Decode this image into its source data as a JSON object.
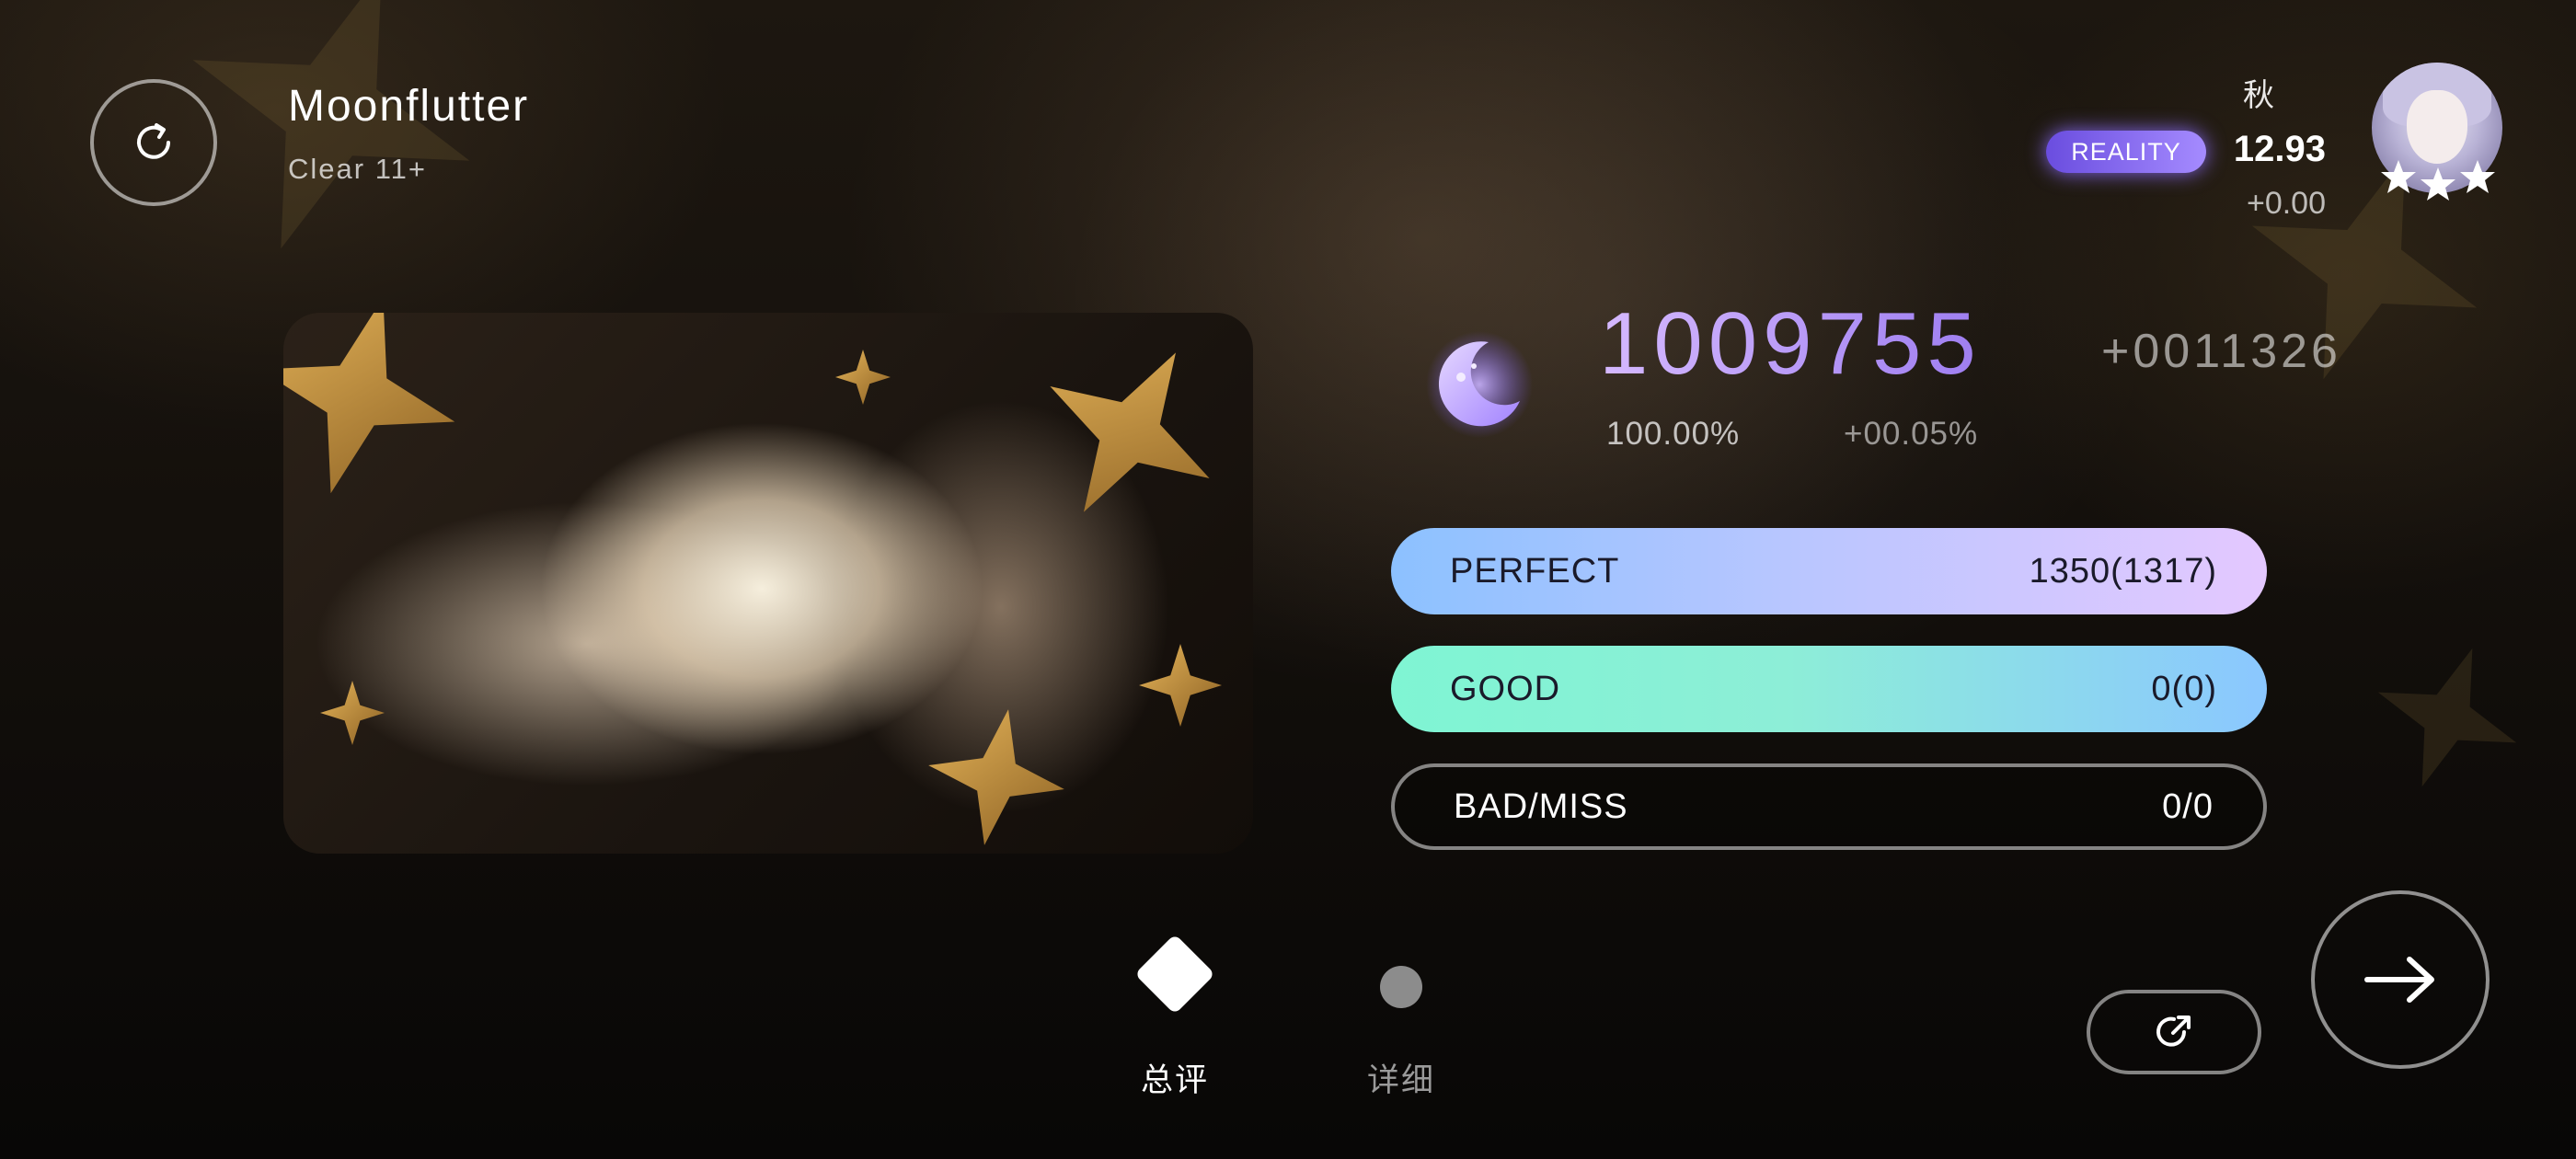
{
  "song": {
    "title": "Moonflutter",
    "difficulty": "Clear 11+"
  },
  "player": {
    "name": "秋",
    "badge": "REALITY",
    "rks": "12.93",
    "rks_delta": "+0.00",
    "stars": 3
  },
  "result": {
    "score": "1009755",
    "score_delta": "+0011326",
    "accuracy": "100.00%",
    "accuracy_delta": "+00.05%"
  },
  "judgements": [
    {
      "label": "PERFECT",
      "value": "1350(1317)"
    },
    {
      "label": "GOOD",
      "value": "0(0)"
    },
    {
      "label": "BAD/MISS",
      "value": "0/0"
    }
  ],
  "tabs": [
    {
      "label": "总评",
      "active": true
    },
    {
      "label": "详细",
      "active": false
    }
  ],
  "icons": {
    "retry": "retry-icon",
    "share": "share-icon",
    "next": "arrow-right-icon",
    "rank": "moon-icon"
  },
  "colors": {
    "score_gradient_start": "#d5b9ff",
    "score_gradient_end": "#9e7ef0",
    "perfect_bar_start": "#8cc1ff",
    "perfect_bar_end": "#e4c8ff",
    "good_bar_start": "#7ff5d3",
    "good_bar_end": "#8bc7ff",
    "badge": "#7c5cf0"
  }
}
